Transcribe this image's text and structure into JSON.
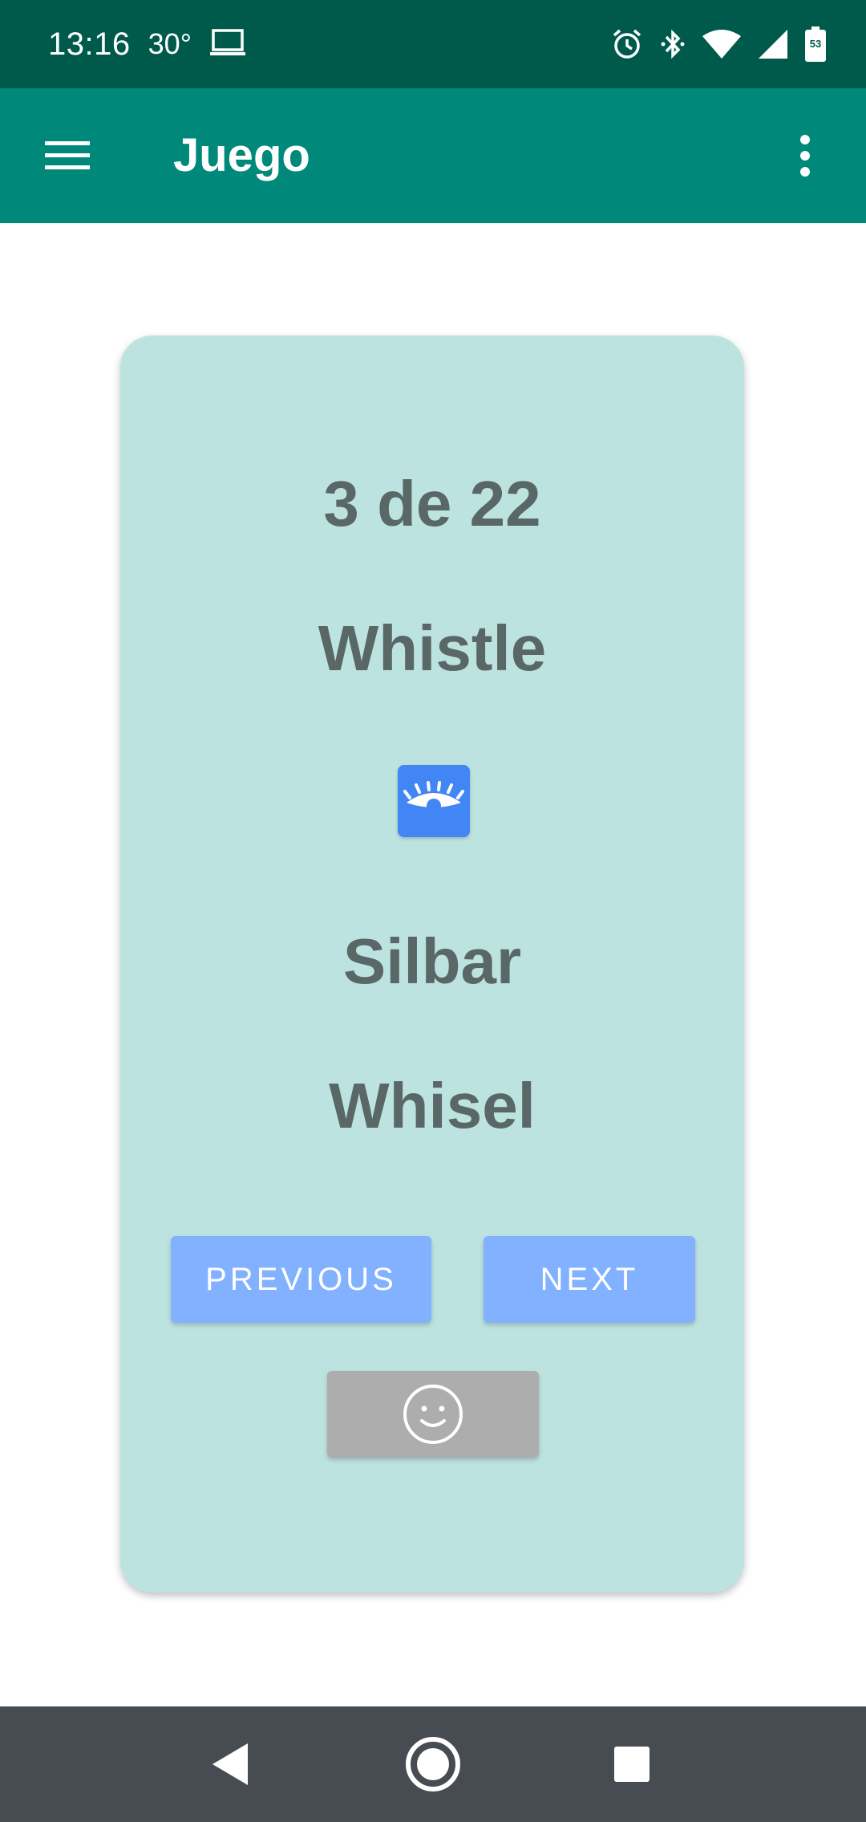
{
  "status_bar": {
    "time": "13:16",
    "temperature": "30°",
    "icons": [
      "laptop-icon",
      "alarm-icon",
      "bluetooth-icon",
      "wifi-icon",
      "signal-icon",
      "battery-icon"
    ],
    "battery_level": "53"
  },
  "app_bar": {
    "title": "Juego",
    "menu_icon": "hamburger-menu-icon",
    "overflow_icon": "more-vert-icon",
    "color": "#00897b"
  },
  "card": {
    "progress": "3 de 22",
    "word": "Whistle",
    "reveal_icon": "eye-icon",
    "translation": "Silbar",
    "pronunciation": "Whisel",
    "buttons": {
      "previous": "PREVIOUS",
      "next": "NEXT",
      "smile_icon": "smile-icon"
    },
    "background": "#bde3e1"
  },
  "nav_bar": {
    "icons": [
      "back-icon",
      "home-icon",
      "recents-icon"
    ]
  }
}
